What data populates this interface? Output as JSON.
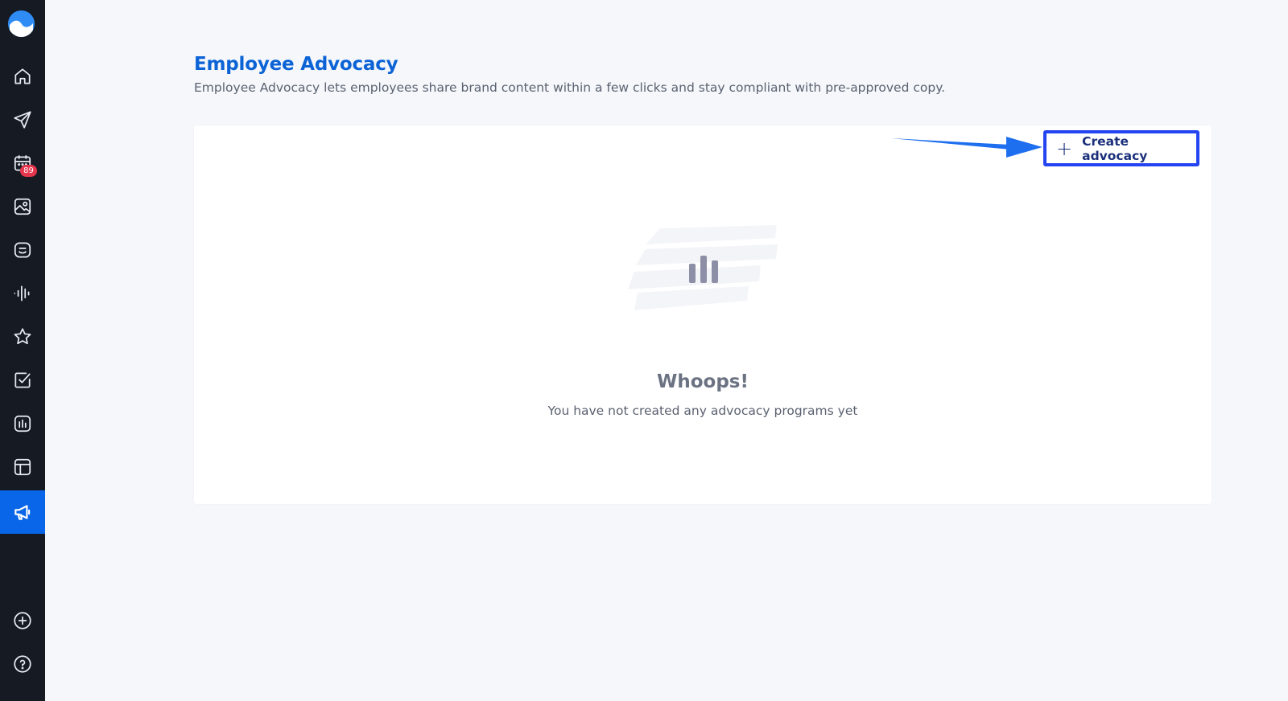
{
  "sidebar": {
    "logo": "wave-logo",
    "items": [
      {
        "icon": "home-icon"
      },
      {
        "icon": "send-icon"
      },
      {
        "icon": "calendar-icon",
        "badge": "89"
      },
      {
        "icon": "media-library-icon"
      },
      {
        "icon": "inbox-icon"
      },
      {
        "icon": "listening-icon"
      },
      {
        "icon": "star-icon"
      },
      {
        "icon": "tasks-icon"
      },
      {
        "icon": "analytics-icon"
      },
      {
        "icon": "layout-icon"
      },
      {
        "icon": "megaphone-icon",
        "active": true
      }
    ],
    "bottom": [
      {
        "icon": "add-circle-icon"
      },
      {
        "icon": "help-icon"
      }
    ]
  },
  "header": {
    "title": "Employee Advocacy",
    "description": "Employee Advocacy lets employees share brand content within a few clicks and stay compliant with pre-approved copy."
  },
  "toolbar": {
    "create_icon": "+",
    "create_label": "Create advocacy"
  },
  "empty_state": {
    "illustration": "bar-chart-icon",
    "title": "Whoops!",
    "message": "You have not created any advocacy programs yet"
  },
  "colors": {
    "sidebar_bg": "#161a23",
    "active_nav": "#0a66e8",
    "title": "#0b63d6",
    "highlight": "#2344f0",
    "badge": "#e5364d"
  }
}
